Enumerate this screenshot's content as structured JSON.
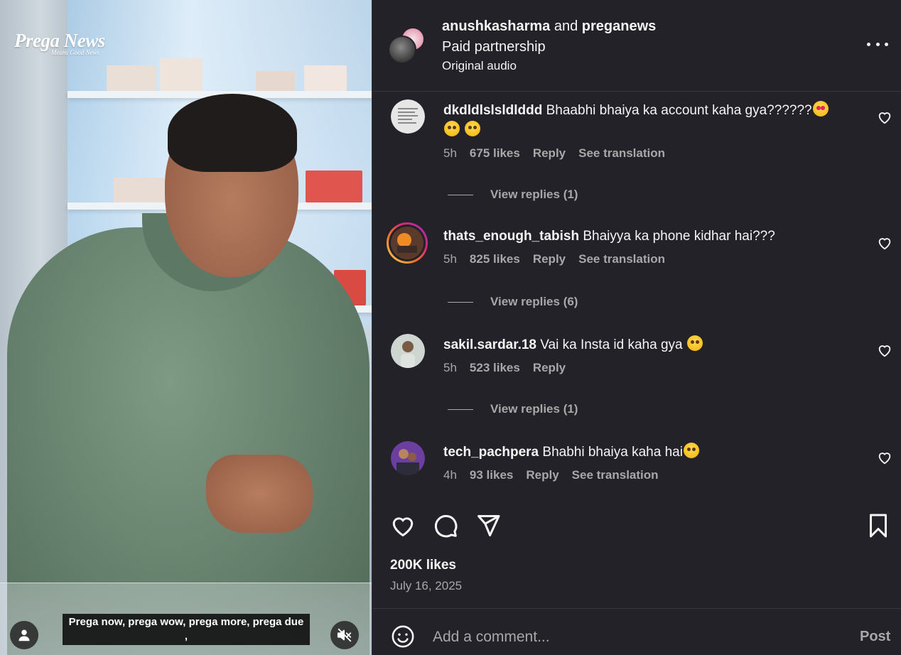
{
  "video": {
    "brand_name": "Prega News",
    "brand_tagline": "Means Good News",
    "caption": "Prega now, prega wow, prega more, prega due ,"
  },
  "post": {
    "author1": "anushkasharma",
    "joiner": "and",
    "author2": "preganews",
    "partnership": "Paid partnership",
    "audio": "Original audio"
  },
  "comments": [
    {
      "username": "dkdldlslsldlddd",
      "text": "Bhaabhi bhaiya ka account kaha gya??????",
      "emojis_end": [
        "heart-eyes",
        "flushed"
      ],
      "emojis_line2": [
        "flushed",
        "flushed"
      ],
      "time": "5h",
      "likes": "675 likes",
      "reply": "Reply",
      "translate": "See translation",
      "view_replies": "View replies (1)"
    },
    {
      "username": "thats_enough_tabish",
      "text": "Bhaiyya ka phone kidhar hai???",
      "time": "5h",
      "likes": "825 likes",
      "reply": "Reply",
      "translate": "See translation",
      "view_replies": "View replies (6)"
    },
    {
      "username": "sakil.sardar.18",
      "text": "Vai ka Insta id kaha gya",
      "emoji": "pleading",
      "time": "5h",
      "likes": "523 likes",
      "reply": "Reply",
      "view_replies": "View replies (1)"
    },
    {
      "username": "tech_pachpera",
      "text": "Bhabhi bhaiya kaha hai",
      "emoji": "pleading",
      "time": "4h",
      "likes": "93 likes",
      "reply": "Reply",
      "translate": "See translation"
    }
  ],
  "stats": {
    "likes": "200K likes",
    "date": "July 16, 2025"
  },
  "composer": {
    "placeholder": "Add a comment...",
    "post_label": "Post"
  },
  "colors": {
    "panel_bg": "#222228",
    "text_primary": "#f5f5f5",
    "text_secondary": "#a8a8a8",
    "divider": "#36363c"
  }
}
